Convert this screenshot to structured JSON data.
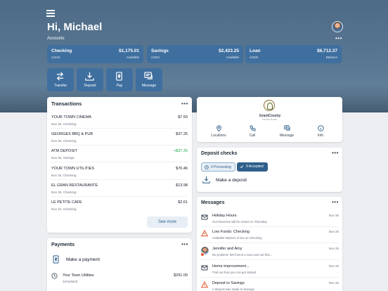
{
  "header": {
    "greeting": "Hi, Michael",
    "accounts_label": "Accounts",
    "more": "•••"
  },
  "accounts": [
    {
      "name": "Checking",
      "amount": "$1,175.01",
      "number": "x1234",
      "sub": "Available"
    },
    {
      "name": "Savings",
      "amount": "$2,423.25",
      "number": "x4321",
      "sub": "Available"
    },
    {
      "name": "Loan",
      "amount": "$6,712.37",
      "number": "x2345",
      "sub": "Balance"
    }
  ],
  "quick_actions": [
    {
      "label": "Transfer",
      "icon": "transfer-icon"
    },
    {
      "label": "Deposit",
      "icon": "deposit-icon"
    },
    {
      "label": "Pay",
      "icon": "pay-icon"
    },
    {
      "label": "Message",
      "icon": "message-icon"
    }
  ],
  "transactions": {
    "title": "Transactions",
    "more": "•••",
    "items": [
      {
        "name": "YOUR TOWN CINEMA",
        "date": "Nov 25, Checking",
        "amount": "$7.50"
      },
      {
        "name": "GEORGES BBQ & PUB",
        "date": "Nov 25, Checking",
        "amount": "$37.25"
      },
      {
        "name": "ATM DEPOSIT",
        "date": "Nov 25, Savings",
        "amount": "+$37.25"
      },
      {
        "name": "YOUR TOWN UTILITIES",
        "date": "Nov 25, Checking",
        "amount": "$76.46"
      },
      {
        "name": "EL GRAN RESTAURANTE",
        "date": "Nov 25, Checking",
        "amount": "$13.98"
      },
      {
        "name": "LE PETITE CAFE",
        "date": "Nov 24, Checking",
        "amount": "$2.61"
      }
    ],
    "see_more": "See more"
  },
  "payments": {
    "title": "Payments",
    "more": "•••",
    "make_payment": "Make a payment",
    "items": [
      {
        "name": "Your Town Utilities",
        "status": "Scheduled",
        "amount": "$291.00"
      }
    ]
  },
  "bank": {
    "name": "GrantCounty",
    "sub": "STATE BANK",
    "actions": [
      {
        "label": "Locations",
        "icon": "location-pin-icon"
      },
      {
        "label": "Call",
        "icon": "phone-icon"
      },
      {
        "label": "Message",
        "icon": "message-icon"
      },
      {
        "label": "Info",
        "icon": "info-icon"
      }
    ]
  },
  "deposit_checks": {
    "title": "Deposit checks",
    "more": "•••",
    "processing": "0 Processing",
    "accepted": "9 Accepted",
    "make_deposit": "Make a deposit"
  },
  "messages": {
    "title": "Messages",
    "more": "•••",
    "items": [
      {
        "title": "Holiday Hours",
        "preview": "Our branches will be closed on Thursday",
        "date": "Nov 25",
        "icon": "envelope-icon"
      },
      {
        "title": "Low Funds: Checking",
        "preview": "Available balance is low on Checking",
        "date": "Nov 25",
        "icon": "warning-icon"
      },
      {
        "title": "Jennifer and Amy",
        "preview": "No problem! We'll send a new card out first...",
        "date": "Nov 25",
        "icon": "avatar-icon"
      },
      {
        "title": "Home improvement...",
        "preview": "Find out how you can get started",
        "date": "Nov 25",
        "icon": "envelope-icon"
      },
      {
        "title": "Deposit to Savings",
        "preview": "A deposit was made to Savings",
        "date": "Nov 25",
        "icon": "warning-icon"
      }
    ]
  },
  "colors": {
    "primary": "#3f6f9f",
    "accent": "#2f5f8a",
    "positive": "#16a34a",
    "warning": "#e4572e"
  }
}
